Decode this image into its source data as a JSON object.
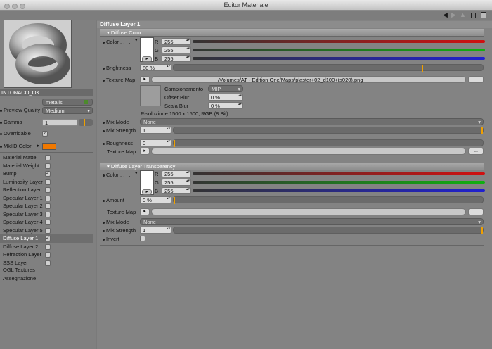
{
  "window": {
    "title": "Editor Materiale"
  },
  "nav": {
    "back": "◀",
    "fwd": "▶",
    "up": "▲"
  },
  "left": {
    "material_name": "INTONACO_OK",
    "layer_field": "metalls",
    "preview_quality_label": "Preview Quality",
    "preview_quality_value": "Medium",
    "gamma_label": "Gamma",
    "gamma_value": "1",
    "overridable_label": "Overridable",
    "mip_color_label": "MkIID Color",
    "channels": [
      {
        "label": "Material Matte",
        "checked": false
      },
      {
        "label": "Material Weight",
        "checked": false
      },
      {
        "label": "Bump",
        "checked": true
      },
      {
        "label": "Luminosity Layer",
        "checked": false
      },
      {
        "label": "Reflection Layer",
        "checked": false
      },
      {
        "label": "Specular Layer 1",
        "checked": false
      },
      {
        "label": "Specular Layer 2",
        "checked": false
      },
      {
        "label": "Specular Layer 3",
        "checked": false
      },
      {
        "label": "Specular Layer 4",
        "checked": false
      },
      {
        "label": "Specular Layer 5",
        "checked": false
      },
      {
        "label": "Diffuse Layer 1",
        "checked": true
      },
      {
        "label": "Diffuse Layer 2",
        "checked": false
      },
      {
        "label": "Refraction Layer",
        "checked": false
      },
      {
        "label": "SSS Layer",
        "checked": false
      }
    ],
    "ogl_textures": "OGL Textures",
    "assegnazione": "Assegnazione"
  },
  "main": {
    "header": "Diffuse Layer 1",
    "diffuse_color": {
      "section": "Diffuse Color",
      "color_label": "Color",
      "r_label": "R",
      "g_label": "G",
      "b_label": "B",
      "r": "255",
      "g": "255",
      "b": "255",
      "brightness_label": "Brightness",
      "brightness": "80 %",
      "brightness_fraction": 0.8,
      "texture_map_label": "Texture Map",
      "texture_path": "/Volumes/AT - Edition One/Maps/plaster+02_d100+(s020).png",
      "campionamento_label": "Campionamento",
      "campionamento": "MIP",
      "offset_blur_label": "Offset Blur",
      "offset_blur": "0 %",
      "scala_blur_label": "Scala Blur",
      "scala_blur": "0 %",
      "risoluzione": "Risoluzione 1500 x 1500, RGB (8 Bit)",
      "mix_mode_label": "Mix Mode",
      "mix_mode": "None",
      "mix_strength_label": "Mix Strength",
      "mix_strength": "1",
      "roughness_label": "Roughness",
      "roughness": "0",
      "texture_map2_label": "Texture Map"
    },
    "transparency": {
      "section": "Diffuse Layer Transparency",
      "color_label": "Color",
      "r_label": "R",
      "g_label": "G",
      "b_label": "B",
      "r": "255",
      "g": "255",
      "b": "255",
      "amount_label": "Amount",
      "amount": "0 %",
      "texture_map_label": "Texture Map",
      "mix_mode_label": "Mix Mode",
      "mix_mode": "None",
      "mix_strength_label": "Mix Strength",
      "mix_strength": "1",
      "invert_label": "Invert"
    },
    "button_ellipsis": "...",
    "button_arrow": "▸"
  },
  "colors": {
    "accent": "#f07800",
    "red": "#d01010",
    "green": "#10b010",
    "blue": "#2020d0"
  }
}
